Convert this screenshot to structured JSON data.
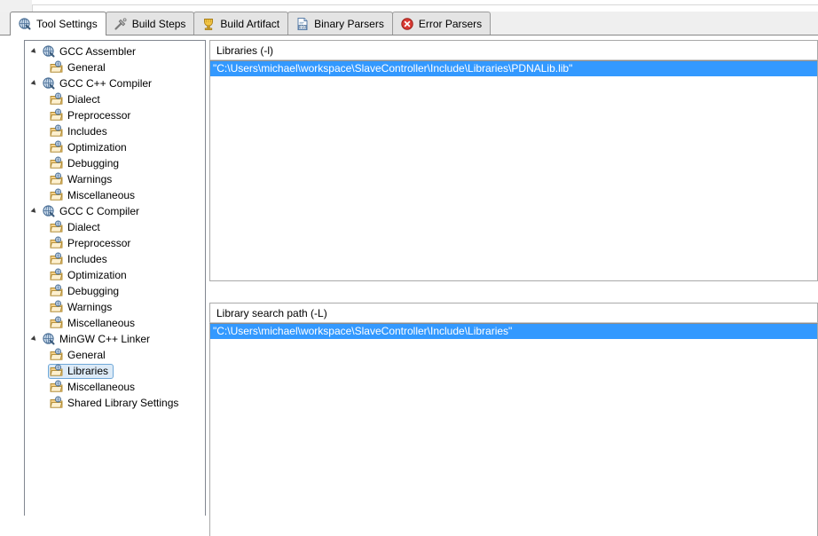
{
  "window": {
    "title": "Tool Settings"
  },
  "tabs": [
    {
      "label": "Tool Settings",
      "icon": "globe-wrench-icon",
      "active": true
    },
    {
      "label": "Build Steps",
      "icon": "hammer-icon",
      "active": false
    },
    {
      "label": "Build Artifact",
      "icon": "artifact-icon",
      "active": false
    },
    {
      "label": "Binary Parsers",
      "icon": "binary-file-icon",
      "active": false
    },
    {
      "label": "Error Parsers",
      "icon": "error-circle-icon",
      "active": false
    }
  ],
  "tree": {
    "items": [
      {
        "label": "GCC Assembler",
        "level": 0,
        "icon": "tool-globe-icon",
        "expandable": true,
        "expanded": true,
        "selected": false
      },
      {
        "label": "General",
        "level": 1,
        "icon": "folder-icon",
        "expandable": false,
        "expanded": false,
        "selected": false
      },
      {
        "label": "GCC C++ Compiler",
        "level": 0,
        "icon": "tool-globe-icon",
        "expandable": true,
        "expanded": true,
        "selected": false
      },
      {
        "label": "Dialect",
        "level": 1,
        "icon": "folder-icon",
        "expandable": false,
        "expanded": false,
        "selected": false
      },
      {
        "label": "Preprocessor",
        "level": 1,
        "icon": "folder-icon",
        "expandable": false,
        "expanded": false,
        "selected": false
      },
      {
        "label": "Includes",
        "level": 1,
        "icon": "folder-icon",
        "expandable": false,
        "expanded": false,
        "selected": false
      },
      {
        "label": "Optimization",
        "level": 1,
        "icon": "folder-icon",
        "expandable": false,
        "expanded": false,
        "selected": false
      },
      {
        "label": "Debugging",
        "level": 1,
        "icon": "folder-icon",
        "expandable": false,
        "expanded": false,
        "selected": false
      },
      {
        "label": "Warnings",
        "level": 1,
        "icon": "folder-icon",
        "expandable": false,
        "expanded": false,
        "selected": false
      },
      {
        "label": "Miscellaneous",
        "level": 1,
        "icon": "folder-icon",
        "expandable": false,
        "expanded": false,
        "selected": false
      },
      {
        "label": "GCC C Compiler",
        "level": 0,
        "icon": "tool-globe-icon",
        "expandable": true,
        "expanded": true,
        "selected": false
      },
      {
        "label": "Dialect",
        "level": 1,
        "icon": "folder-icon",
        "expandable": false,
        "expanded": false,
        "selected": false
      },
      {
        "label": "Preprocessor",
        "level": 1,
        "icon": "folder-icon",
        "expandable": false,
        "expanded": false,
        "selected": false
      },
      {
        "label": "Includes",
        "level": 1,
        "icon": "folder-icon",
        "expandable": false,
        "expanded": false,
        "selected": false
      },
      {
        "label": "Optimization",
        "level": 1,
        "icon": "folder-icon",
        "expandable": false,
        "expanded": false,
        "selected": false
      },
      {
        "label": "Debugging",
        "level": 1,
        "icon": "folder-icon",
        "expandable": false,
        "expanded": false,
        "selected": false
      },
      {
        "label": "Warnings",
        "level": 1,
        "icon": "folder-icon",
        "expandable": false,
        "expanded": false,
        "selected": false
      },
      {
        "label": "Miscellaneous",
        "level": 1,
        "icon": "folder-icon",
        "expandable": false,
        "expanded": false,
        "selected": false
      },
      {
        "label": "MinGW C++ Linker",
        "level": 0,
        "icon": "tool-globe-icon",
        "expandable": true,
        "expanded": true,
        "selected": false
      },
      {
        "label": "General",
        "level": 1,
        "icon": "folder-icon",
        "expandable": false,
        "expanded": false,
        "selected": false
      },
      {
        "label": "Libraries",
        "level": 1,
        "icon": "folder-icon",
        "expandable": false,
        "expanded": false,
        "selected": true
      },
      {
        "label": "Miscellaneous",
        "level": 1,
        "icon": "folder-icon",
        "expandable": false,
        "expanded": false,
        "selected": false
      },
      {
        "label": "Shared Library Settings",
        "level": 1,
        "icon": "folder-icon",
        "expandable": false,
        "expanded": false,
        "selected": false
      }
    ]
  },
  "panels": {
    "libraries": {
      "header": "Libraries (-l)",
      "entries": [
        {
          "value": "\"C:\\Users\\michael\\workspace\\SlaveController\\Include\\Libraries\\PDNALib.lib\"",
          "selected": true
        }
      ]
    },
    "library_search_path": {
      "header": "Library search path (-L)",
      "entries": [
        {
          "value": "\"C:\\Users\\michael\\workspace\\SlaveController\\Include\\Libraries\"",
          "selected": true
        }
      ]
    }
  },
  "colors": {
    "selection_blue": "#3399ff",
    "tree_selection_fill": "#dceaf7",
    "tree_selection_border": "#6fa8d8",
    "tabbar_bg": "#efefef",
    "active_tab_bg": "#ffffff"
  }
}
